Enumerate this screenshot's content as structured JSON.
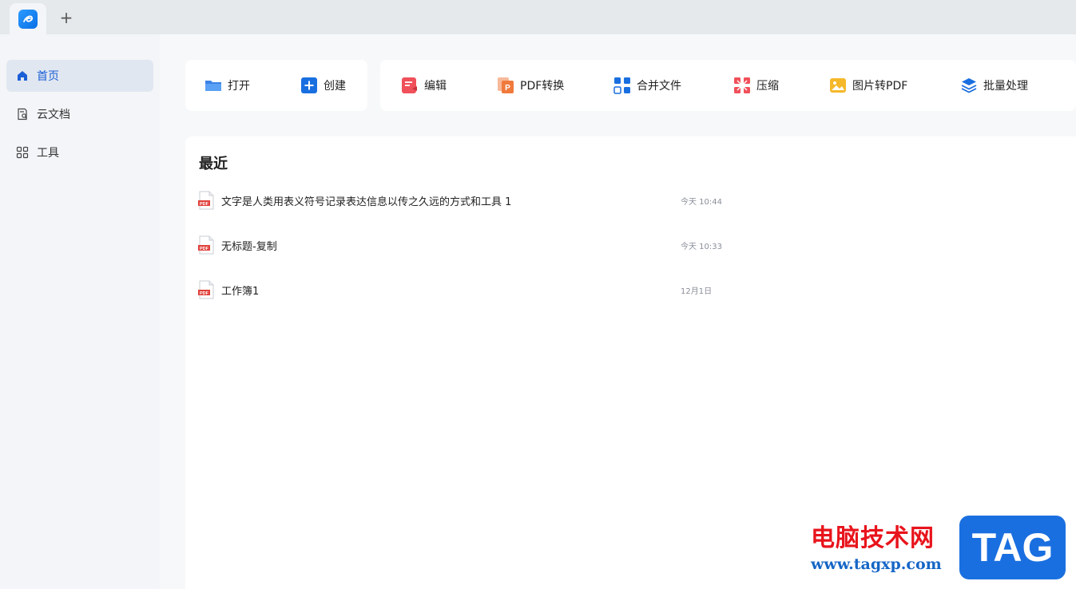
{
  "tabbar": {
    "new_tab_symbol": "+"
  },
  "sidebar": {
    "items": [
      {
        "label": "首页",
        "icon": "home-icon",
        "active": true
      },
      {
        "label": "云文档",
        "icon": "cloud-doc-icon",
        "active": false
      },
      {
        "label": "工具",
        "icon": "grid-icon",
        "active": false
      }
    ]
  },
  "toolbar": {
    "open_label": "打开",
    "create_label": "创建",
    "edit_label": "编辑",
    "pdf_convert_label": "PDF转换",
    "merge_label": "合并文件",
    "compress_label": "压缩",
    "image_to_pdf_label": "图片转PDF",
    "batch_label": "批量处理"
  },
  "recent": {
    "title": "最近",
    "pdf_badge": "PDF",
    "files": [
      {
        "name": "文字是人类用表义符号记录表达信息以传之久远的方式和工具 1",
        "time": "今天 10:44"
      },
      {
        "name": "无标题-复制",
        "time": "今天 10:33"
      },
      {
        "name": "工作簿1",
        "time": "12月1日"
      }
    ]
  },
  "watermark": {
    "cn": "电脑技术网",
    "url": "www.tagxp.com",
    "tag": "TAG"
  },
  "colors": {
    "accent": "#1a5fd6",
    "pdf_red": "#e0403a",
    "edit_red": "#f0505a",
    "convert_orange": "#f07a3c",
    "image_yellow": "#f5b82a"
  }
}
